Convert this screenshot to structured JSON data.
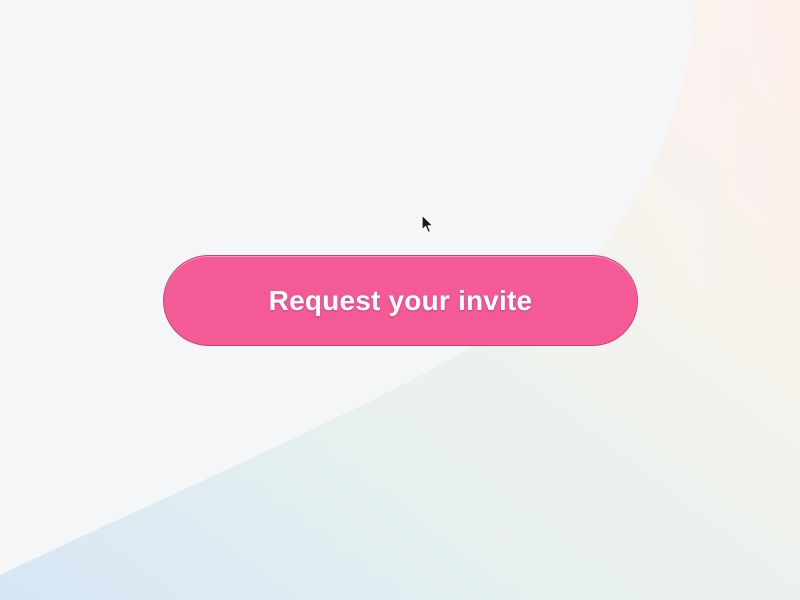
{
  "button": {
    "label": "Request your invite"
  },
  "colors": {
    "button_background": "#f45b96",
    "page_background": "#f5f6f8",
    "label_text": "#ffffff",
    "cursor": "#1a1a1a"
  },
  "icons": {
    "cursor": "arrow-pointer-icon"
  }
}
